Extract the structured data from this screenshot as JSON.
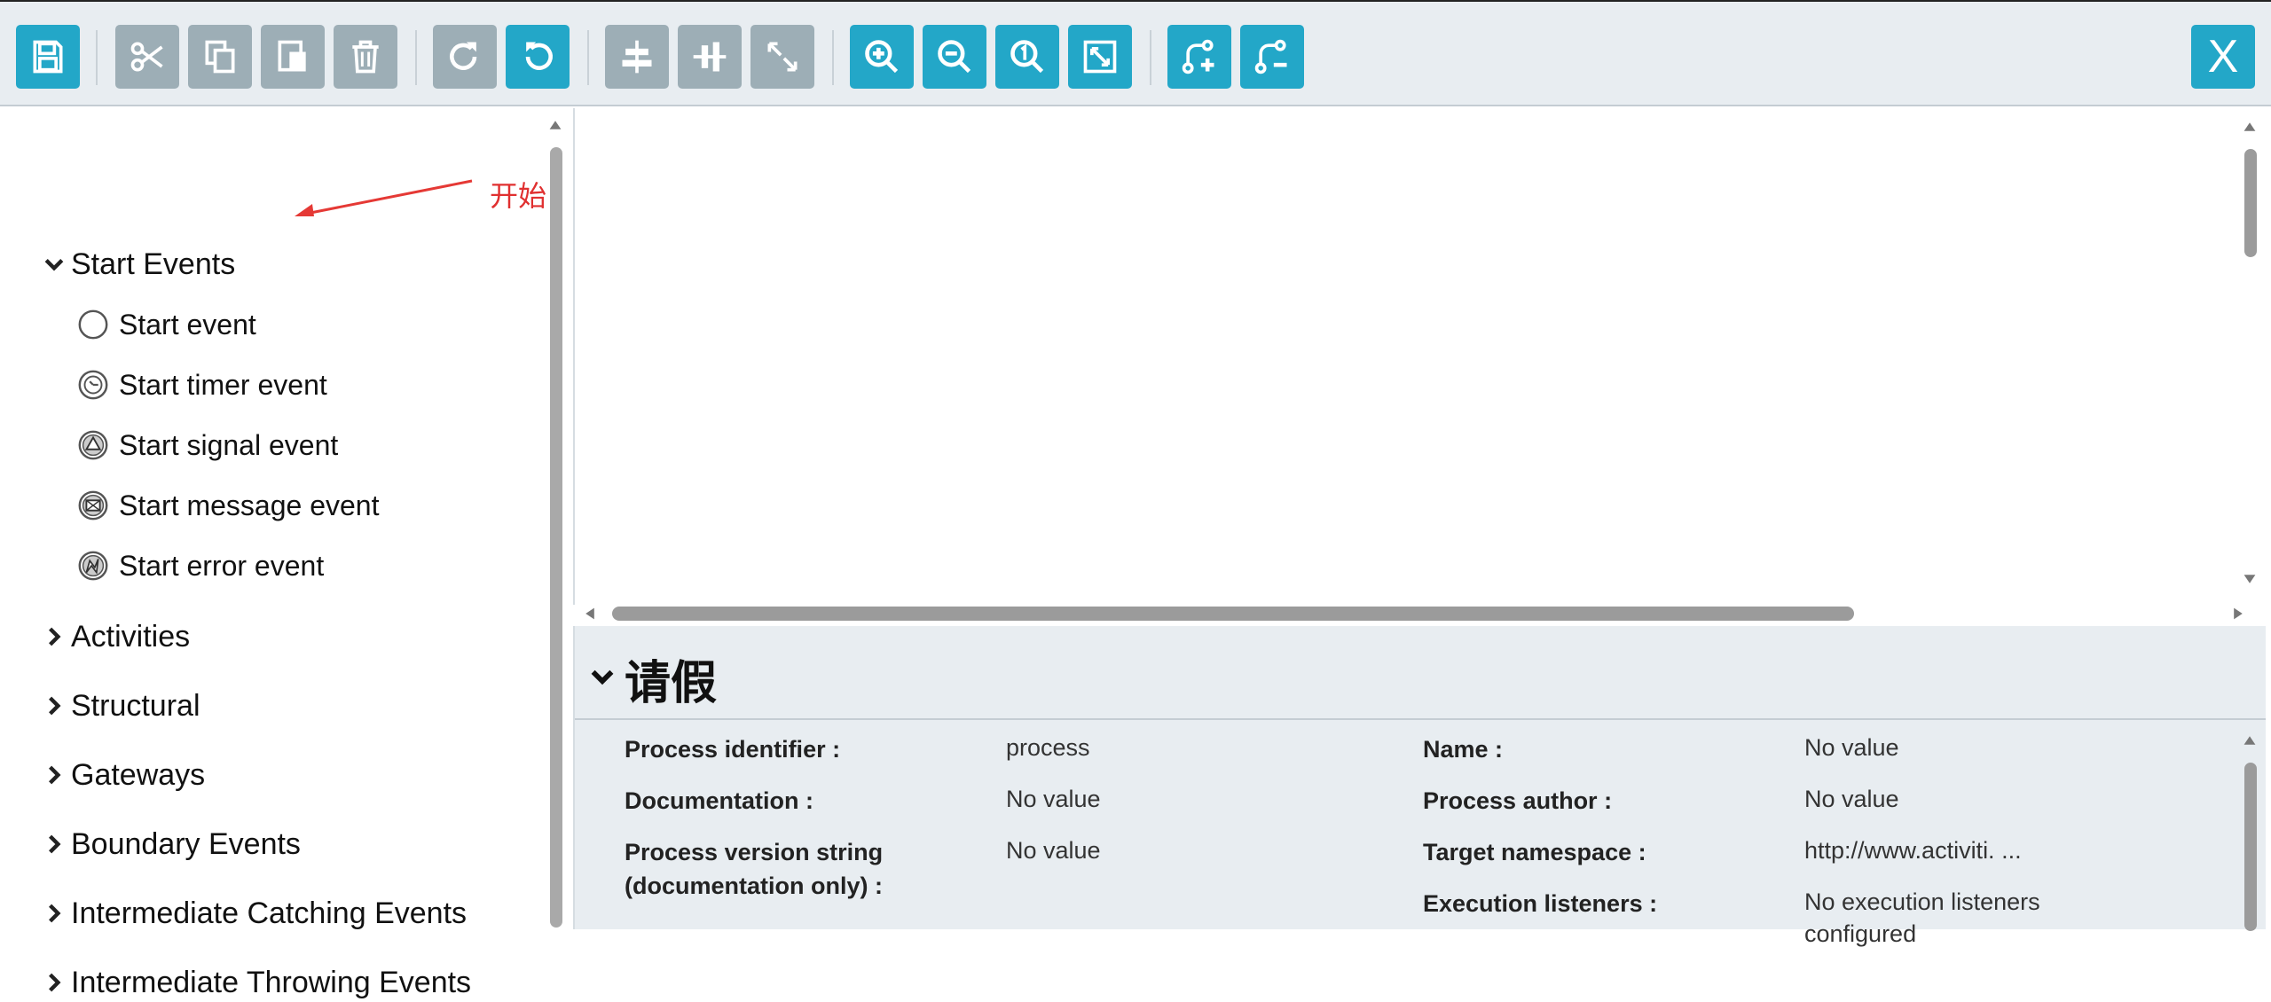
{
  "toolbar": {
    "buttons": [
      {
        "name": "save-icon"
      },
      {
        "name": "cut-icon"
      },
      {
        "name": "copy-icon"
      },
      {
        "name": "paste-icon"
      },
      {
        "name": "delete-icon"
      },
      {
        "name": "redo-icon"
      },
      {
        "name": "undo-icon"
      },
      {
        "name": "align-horizontal-icon"
      },
      {
        "name": "align-vertical-icon"
      },
      {
        "name": "same-size-icon"
      },
      {
        "name": "zoom-in-icon"
      },
      {
        "name": "zoom-out-icon"
      },
      {
        "name": "zoom-actual-icon"
      },
      {
        "name": "zoom-fit-icon"
      },
      {
        "name": "add-bendpoint-icon"
      },
      {
        "name": "remove-bendpoint-icon"
      }
    ],
    "close_label": "X",
    "colors": {
      "grey": "#9daeb6",
      "blue": "#23a7c8",
      "background": "#e8edf1"
    }
  },
  "palette": {
    "expanded_group": {
      "label": "Start Events",
      "items": [
        {
          "label": "Start event",
          "icon": "circle-icon"
        },
        {
          "label": "Start timer event",
          "icon": "timer-icon"
        },
        {
          "label": "Start signal event",
          "icon": "signal-icon"
        },
        {
          "label": "Start message event",
          "icon": "message-icon"
        },
        {
          "label": "Start error event",
          "icon": "error-icon"
        }
      ]
    },
    "groups": [
      {
        "label": "Activities"
      },
      {
        "label": "Structural"
      },
      {
        "label": "Gateways"
      },
      {
        "label": "Boundary Events"
      },
      {
        "label": "Intermediate Catching Events"
      },
      {
        "label": "Intermediate Throwing Events"
      }
    ]
  },
  "annotation": {
    "text": "开始",
    "color": "#e03030"
  },
  "properties": {
    "title": "请假",
    "fields": {
      "process_identifier": {
        "label": "Process identifier :",
        "value": "process"
      },
      "name": {
        "label": "Name :",
        "value": "No value"
      },
      "documentation": {
        "label": "Documentation :",
        "value": "No value"
      },
      "process_author": {
        "label": "Process author :",
        "value": "No value"
      },
      "version_line1": {
        "label": "Process version string",
        "label2": "(documentation only) :",
        "value": "No value"
      },
      "target_namespace": {
        "label": "Target namespace :",
        "value": "http://www.activiti. ..."
      },
      "execution_listeners": {
        "label": "Execution listeners :",
        "value": "No execution listeners",
        "value2": "configured"
      }
    }
  }
}
